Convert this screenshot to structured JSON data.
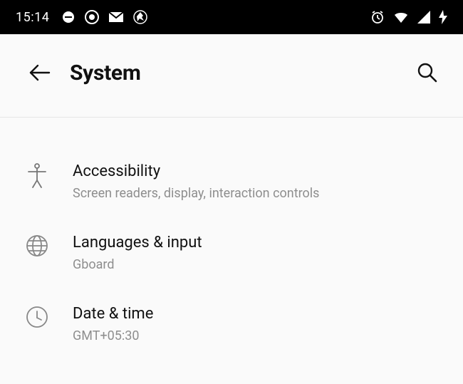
{
  "statusbar": {
    "time": "15:14"
  },
  "header": {
    "title": "System"
  },
  "settings": [
    {
      "icon": "accessibility-icon",
      "title": "Accessibility",
      "subtitle": "Screen readers, display, interaction controls"
    },
    {
      "icon": "language-icon",
      "title": "Languages & input",
      "subtitle": "Gboard"
    },
    {
      "icon": "clock-icon",
      "title": "Date & time",
      "subtitle": "GMT+05:30"
    }
  ]
}
